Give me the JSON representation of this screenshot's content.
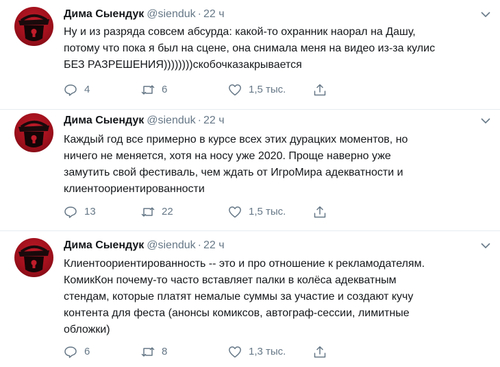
{
  "tweets": [
    {
      "author_name": "Дима Сыендук",
      "handle": "@sienduk",
      "dot": "·",
      "time": "22 ч",
      "text": "Ну и из разряда совсем абсурда: какой-то охранник наорал на Дашу,\nпотому что пока я был на сцене, она снимала меня на видео из-за кулис\nБЕЗ РАЗРЕШЕНИЯ))))))))скобочказакрывается",
      "replies": "4",
      "retweets": "6",
      "likes": "1,5 тыс."
    },
    {
      "author_name": "Дима Сыендук",
      "handle": "@sienduk",
      "dot": "·",
      "time": "22 ч",
      "text": "Каждый год все примерно в курсе всех этих дурацких моментов, но\nничего не меняется, хотя на носу уже 2020. Проще наверно уже\nзамутить свой фестиваль, чем ждать от ИгроМира адекватности и\nклиентоориентированности",
      "replies": "13",
      "retweets": "22",
      "likes": "1,5 тыс."
    },
    {
      "author_name": "Дима Сыендук",
      "handle": "@sienduk",
      "dot": "·",
      "time": "22 ч",
      "text": "Клиентоориентированность -- это и про отношение к рекламодателям.\nКомикКон почему-то часто вставляет палки в колёса адекватным\nстендам, которые платят немалые суммы за участие и создают кучу\nконтента для феста (анонсы комиксов, автограф-сессии, лимитные\nобложки)",
      "replies": "6",
      "retweets": "8",
      "likes": "1,3 тыс."
    }
  ],
  "icons": {
    "reply": "reply-icon",
    "retweet": "retweet-icon",
    "like": "heart-icon",
    "share": "share-icon",
    "menu": "chevron-down-icon",
    "avatar": "avatar"
  },
  "colors": {
    "text": "#14171a",
    "muted": "#657786",
    "avatar_red": "#c01c2a",
    "divider": "#e6ecf0"
  }
}
